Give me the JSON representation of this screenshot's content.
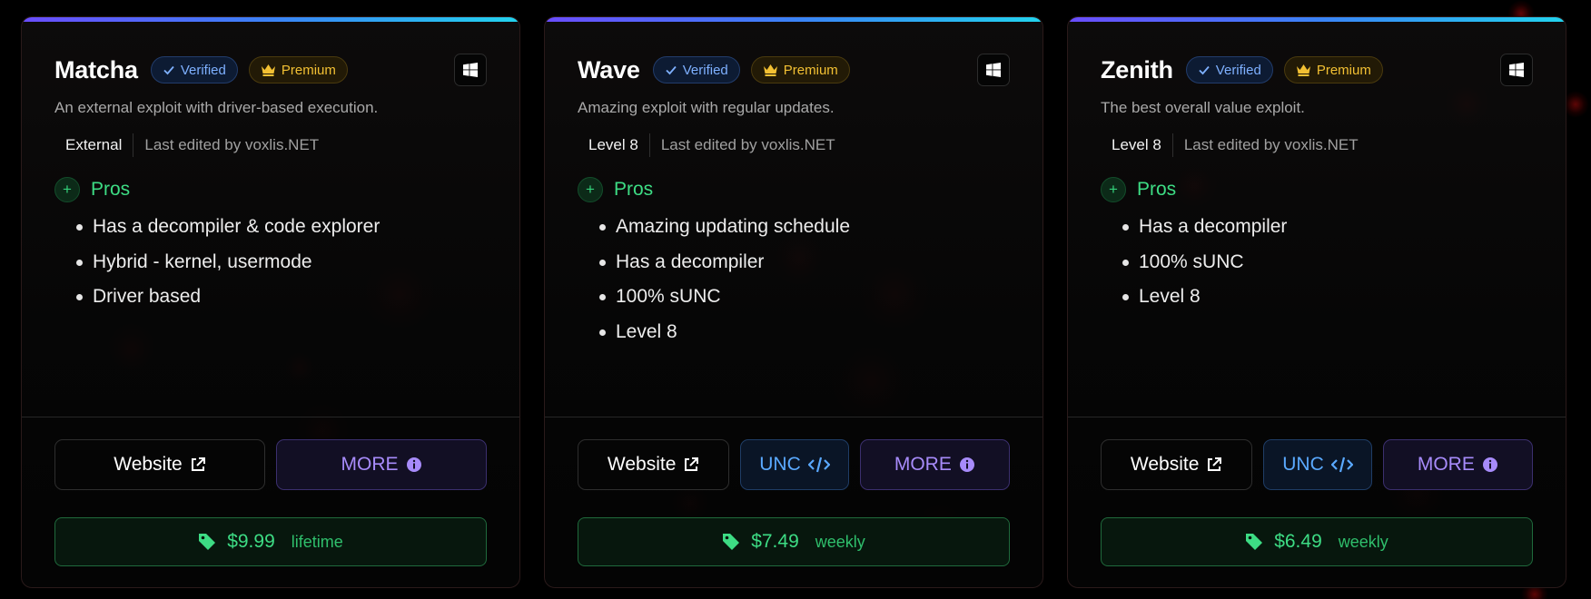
{
  "cards": [
    {
      "name": "Matcha",
      "badges": {
        "verified": "Verified",
        "premium": "Premium"
      },
      "os_icon": "windows-icon",
      "description": "An external exploit with driver-based execution.",
      "tag": "External",
      "edited": "Last edited by voxlis.NET",
      "pros_label": "Pros",
      "pros": [
        "Has a decompiler & code explorer",
        "Hybrid - kernel, usermode",
        "Driver based"
      ],
      "buttons": {
        "website": "Website",
        "more": "MORE"
      },
      "price": "$9.99",
      "period": "lifetime"
    },
    {
      "name": "Wave",
      "badges": {
        "verified": "Verified",
        "premium": "Premium"
      },
      "os_icon": "windows-icon",
      "description": "Amazing exploit with regular updates.",
      "tag": "Level 8",
      "edited": "Last edited by voxlis.NET",
      "pros_label": "Pros",
      "pros": [
        "Amazing updating schedule",
        "Has a decompiler",
        "100% sUNC",
        "Level 8"
      ],
      "buttons": {
        "website": "Website",
        "unc": "UNC",
        "more": "MORE"
      },
      "price": "$7.49",
      "period": "weekly"
    },
    {
      "name": "Zenith",
      "badges": {
        "verified": "Verified",
        "premium": "Premium"
      },
      "os_icon": "windows-icon",
      "description": "The best overall value exploit.",
      "tag": "Level 8",
      "edited": "Last edited by voxlis.NET",
      "pros_label": "Pros",
      "pros": [
        "Has a decompiler",
        "100% sUNC",
        "Level 8"
      ],
      "buttons": {
        "website": "Website",
        "unc": "UNC",
        "more": "MORE"
      },
      "price": "$6.49",
      "period": "weekly"
    }
  ],
  "colors": {
    "accent_gradient": [
      "#6a4dff",
      "#3b82f6",
      "#22d3ee"
    ],
    "pros_green": "#3ddc84",
    "verified_blue": "#7eb0ff",
    "premium_gold": "#f2c033",
    "unc_blue": "#5aa9ff",
    "more_purple": "#a78bfa"
  }
}
